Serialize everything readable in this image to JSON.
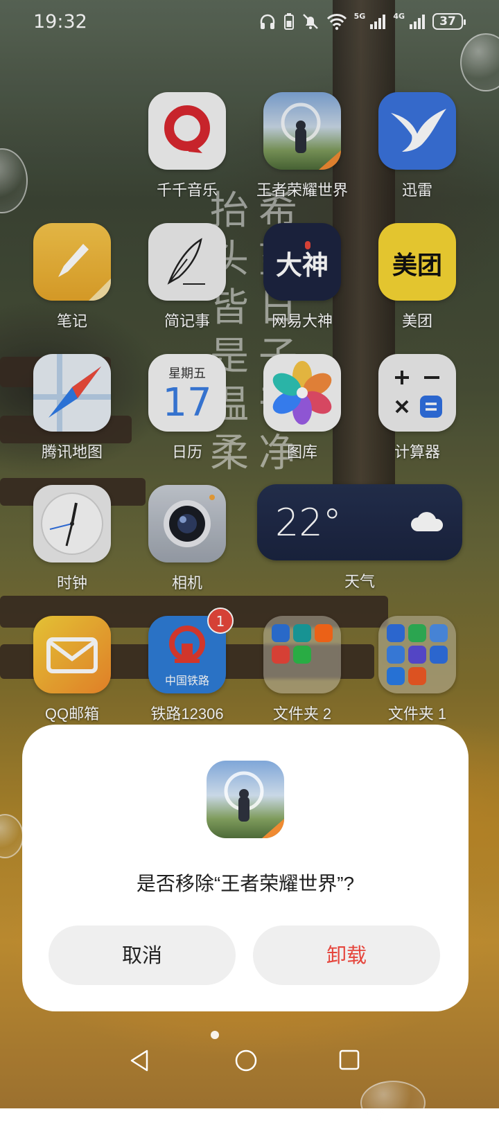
{
  "status_bar": {
    "time": "19:32",
    "network_1": "5G",
    "network_2": "4G",
    "battery": "37"
  },
  "apps": {
    "qianqian": "千千音乐",
    "wangzhe": "王者荣耀世界",
    "xunlei": "迅雷",
    "biji": "笔记",
    "jianjishi": "简记事",
    "wangyidashen": "网易大神",
    "wangyidashen_icon_text": "大神",
    "meituan": "美团",
    "meituan_icon_text": "美团",
    "tengxunditu": "腾讯地图",
    "rili": "日历",
    "rili_weekday": "星期五",
    "rili_day": "17",
    "tuku": "图库",
    "jisuanqi": "计算器",
    "shizhong": "时钟",
    "xiangji": "相机",
    "tianqi": "天气",
    "qqyouxiang": "QQ邮箱",
    "tielu": "铁路12306",
    "tielu_icon_text": "中国铁路",
    "tielu_badge": "1",
    "folder2": "文件夹 2",
    "folder1": "文件夹 1"
  },
  "weather": {
    "temperature": "22°"
  },
  "wallpaper_poem": {
    "col1": "抬头皆是温柔",
    "col2": "希望日子干净"
  },
  "dialog": {
    "title": "是否移除“王者荣耀世界”?",
    "cancel": "取消",
    "uninstall": "卸载"
  },
  "colors": {
    "uninstall_red": "#e5453c",
    "badge_red": "#e8473b"
  }
}
